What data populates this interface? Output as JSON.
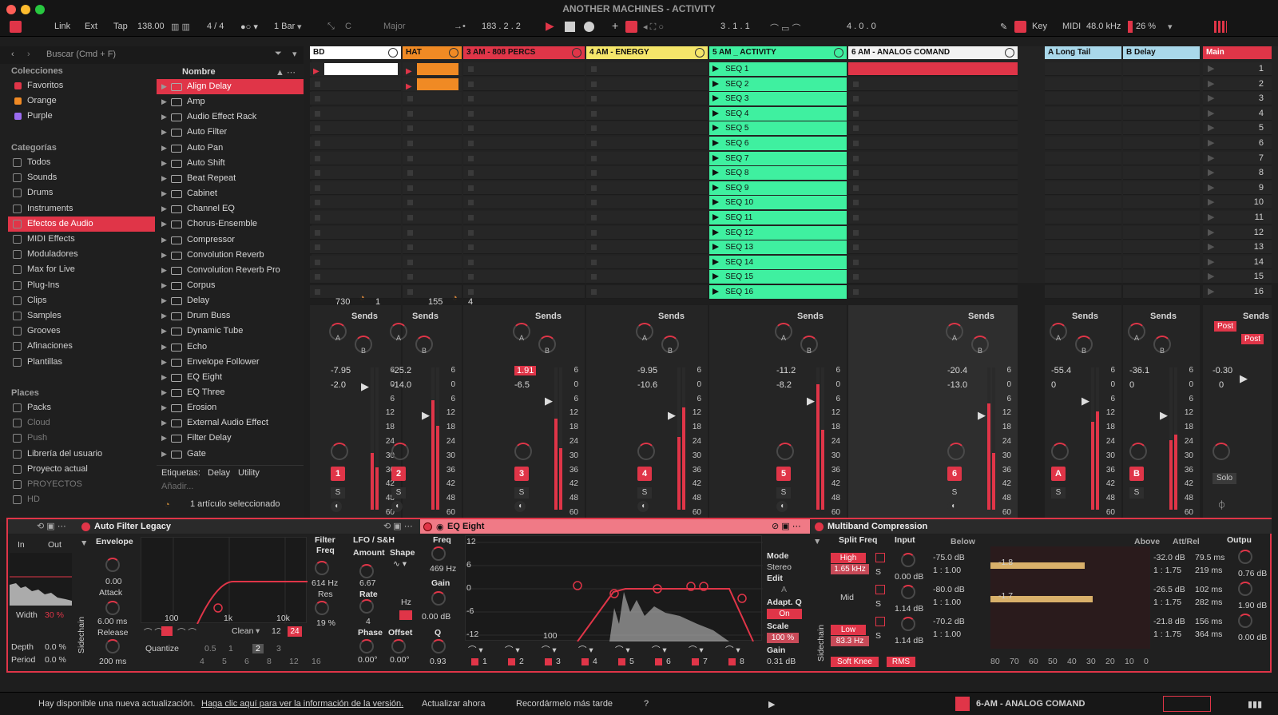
{
  "window": {
    "title": "ANOTHER MACHINES - ACTIVITY"
  },
  "control_bar": {
    "link": "Link",
    "ext": "Ext",
    "tap": "Tap",
    "tempo": "138.00",
    "signature": "4 / 4",
    "quantize": "1 Bar",
    "key_root": "C",
    "scale": "Major",
    "position": "183 .  2 .  2",
    "loop_start": "3 .  1 .  1",
    "loop_length": "4 .  0 .  0",
    "key": "Key",
    "midi": "MIDI",
    "sample_rate": "48.0 kHz",
    "cpu": "26 %"
  },
  "browser": {
    "search_placeholder": "Buscar (Cmd + F)",
    "collections_header": "Colecciones",
    "collections": [
      {
        "label": "Favoritos",
        "color": "#e03548"
      },
      {
        "label": "Orange",
        "color": "#f08a24"
      },
      {
        "label": "Purple",
        "color": "#9b6cf0"
      }
    ],
    "categories_header": "Categorías",
    "categories": [
      "Todos",
      "Sounds",
      "Drums",
      "Instruments",
      "Efectos de Audio",
      "MIDI Effects",
      "Moduladores",
      "Max for Live",
      "Plug-Ins",
      "Clips",
      "Samples",
      "Grooves",
      "Afinaciones",
      "Plantillas"
    ],
    "places_header": "Places",
    "places": [
      "Packs",
      "Cloud",
      "Push",
      "Librería del usuario",
      "Proyecto actual",
      "PROYECTOS",
      "HD"
    ],
    "name_header": "Nombre",
    "items": [
      "Align Delay",
      "Amp",
      "Audio Effect Rack",
      "Auto Filter",
      "Auto Pan",
      "Auto Shift",
      "Beat Repeat",
      "Cabinet",
      "Channel EQ",
      "Chorus-Ensemble",
      "Compressor",
      "Convolution Reverb",
      "Convolution Reverb Pro",
      "Corpus",
      "Delay",
      "Drum Buss",
      "Dynamic Tube",
      "Echo",
      "Envelope Follower",
      "EQ Eight",
      "EQ Three",
      "Erosion",
      "External Audio Effect",
      "Filter Delay",
      "Gate"
    ],
    "tags_label": "Etiquetas:",
    "tags": [
      "Delay",
      "Utility"
    ],
    "add": "Añadir...",
    "selected_count": "1 artículo seleccionado"
  },
  "tracks": [
    {
      "name": "BD",
      "color": "#ffffff",
      "vol": "-7.95",
      "pan": "-2.0",
      "num": "1",
      "extra": "730",
      "extra2": "1"
    },
    {
      "name": "HAT",
      "color": "#f08a24",
      "vol": "-25.2",
      "pan": "-14.0",
      "num": "2",
      "extra": "155",
      "extra2": "4"
    },
    {
      "name": "3 AM - 808 PERCS",
      "color": "#e03548",
      "vol": "1.91",
      "pan": "-6.5",
      "num": "3"
    },
    {
      "name": "4 AM - ENERGY",
      "color": "#f5e66a",
      "vol": "-9.95",
      "pan": "-10.6",
      "num": "4"
    },
    {
      "name": "5 AM _ ACTIVITY",
      "color": "#3ff0a0",
      "vol": "-11.2",
      "pan": "-8.2",
      "num": "5"
    },
    {
      "name": "6 AM -  ANALOG COMAND",
      "color": "#f2f2f2",
      "vol": "-20.4",
      "pan": "-13.0",
      "num": "6"
    }
  ],
  "returns": [
    {
      "name": "A Long Tail",
      "vol": "-55.4",
      "pan": "0",
      "num": "A"
    },
    {
      "name": "B Delay",
      "vol": "-36.1",
      "pan": "0",
      "num": "B"
    }
  ],
  "main": {
    "name": "Main",
    "vol": "-0.30",
    "pan": "0",
    "solo": "Solo",
    "post": "Post"
  },
  "sends_label": "Sends",
  "knob_a": "A",
  "knob_b": "B",
  "solo_s": "S",
  "meter_scale": [
    "6",
    "0",
    "6",
    "12",
    "18",
    "24",
    "30",
    "36",
    "42",
    "48",
    "60"
  ],
  "clips": [
    "SEQ 1",
    "SEQ 2",
    "SEQ 3",
    "SEQ 4",
    "SEQ 5",
    "SEQ 6",
    "SEQ 7",
    "SEQ 8",
    "SEQ 9",
    "SEQ 10",
    "SEQ 11",
    "SEQ 12",
    "SEQ 13",
    "SEQ 14",
    "SEQ 15",
    "SEQ 16"
  ],
  "scenes": [
    "1",
    "2",
    "3",
    "4",
    "5",
    "6",
    "7",
    "8",
    "9",
    "10",
    "11",
    "12",
    "13",
    "14",
    "15",
    "16"
  ],
  "auto_filter": {
    "title": "Auto Filter Legacy",
    "in": "In",
    "out": "Out",
    "envelope": "Envelope",
    "env_val": "0.00",
    "attack": "Attack",
    "attack_val": "6.00 ms",
    "release": "Release",
    "release_val": "200 ms",
    "width": "Width",
    "width_val": "30 %",
    "depth": "Depth",
    "depth_val": "0.0 %",
    "period": "Period",
    "period_val": "0.0 %",
    "sidechain": "Sidechain",
    "freq_ticks": [
      "100",
      "1k",
      "10k"
    ],
    "clean": "Clean",
    "clean_n": "12",
    "clean_n2": "24",
    "quantize": "Quantize",
    "q_vals": [
      "0.5",
      "1",
      "2",
      "3",
      "4",
      "5",
      "6",
      "8",
      "12",
      "16"
    ],
    "filter": "Filter",
    "freq": "Freq",
    "freq_val": "614 Hz",
    "res": "Res",
    "res_val": "19 %",
    "lfo": "LFO / S&H",
    "amount": "Amount",
    "amount_val": "6.67",
    "shape": "Shape",
    "rate": "Rate",
    "rate_val": "4",
    "hz": "Hz",
    "phase": "Phase",
    "phase_val": "0.00°",
    "offset": "Offset",
    "offset_val": "0.00°"
  },
  "eq_eight": {
    "title": "EQ Eight",
    "freq": "Freq",
    "freq_val": "469 Hz",
    "gain": "Gain",
    "gain_val": "0.00 dB",
    "q": "Q",
    "q_val": "0.93",
    "db_ticks": [
      "12",
      "6",
      "0",
      "-6",
      "-12"
    ],
    "x_tick": "100",
    "mode": "Mode",
    "mode_val": "Stereo",
    "edit": "Edit",
    "edit_val": "A",
    "adapt": "Adapt. Q",
    "adapt_val": "On",
    "scale": "Scale",
    "scale_val": "100 %",
    "gain2": "Gain",
    "gain2_val": "0.31 dB",
    "bands": [
      "1",
      "2",
      "3",
      "4",
      "5",
      "6",
      "7",
      "8"
    ]
  },
  "multiband": {
    "title": "Multiband Compression",
    "split": "Split Freq",
    "input": "Input",
    "below": "Below",
    "above": "Above",
    "attrel": "Att/Rel",
    "output": "Outpu",
    "high": "High",
    "high_freq": "1.65 kHz",
    "mid": "Mid",
    "low": "Low",
    "low_freq": "83.3 Hz",
    "input_vals": [
      "0.00 dB",
      "1.14 dB",
      "1.14 dB"
    ],
    "below_db": [
      "-75.0 dB",
      "-80.0 dB",
      "-70.2 dB"
    ],
    "below_ratio": [
      "1 : 1.00",
      "1 : 1.00",
      "1 : 1.00"
    ],
    "gr": [
      "-1.8",
      "-1.7"
    ],
    "above_db": [
      "-32.0 dB",
      "-26.5 dB",
      "-21.8 dB"
    ],
    "above_ratio": [
      "1 : 1.75",
      "1 : 1.75",
      "1 : 1.75"
    ],
    "att": [
      "79.5 ms",
      "102 ms",
      "156 ms"
    ],
    "rel": [
      "219 ms",
      "282 ms",
      "364 ms"
    ],
    "out": [
      "0.76 dB",
      "1.90 dB",
      "0.00 dB"
    ],
    "soft_knee": "Soft Knee",
    "rms": "RMS",
    "scale": [
      "80",
      "70",
      "60",
      "50",
      "40",
      "30",
      "20",
      "10",
      "0"
    ],
    "sidechain": "Sidechain"
  },
  "status": {
    "message": "Hay disponible una nueva actualización.",
    "link": "Haga clic aquí para ver la información de la versión.",
    "update": "Actualizar ahora",
    "later": "Recordármelo más tarde",
    "help": "?",
    "track": "6-AM - ANALOG COMAND"
  }
}
